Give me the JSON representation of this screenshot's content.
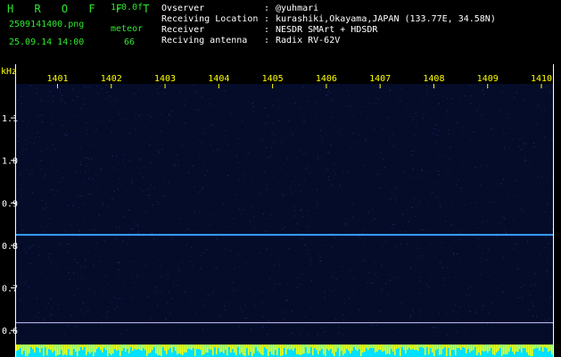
{
  "header": {
    "title": "H R O F F T",
    "version": "1.0.0f",
    "filename": "2509141400.png",
    "timestamp": "25.09.14 14:00",
    "mode_label": "meteor",
    "count": "66",
    "info": [
      {
        "label": "Ovserver",
        "value": "@yuhmari"
      },
      {
        "label": "Receiving Location",
        "value": "kurashiki,Okayama,JAPAN (133.77E, 34.58N)"
      },
      {
        "label": "Receiver",
        "value": "NESDR SMArt + HDSDR"
      },
      {
        "label": "Reciving antenna",
        "value": "Radix RV-62V"
      }
    ]
  },
  "chart_data": {
    "type": "heatmap",
    "y_unit": "kHz",
    "x_ticks": [
      "1401",
      "1402",
      "1403",
      "1404",
      "1405",
      "1406",
      "1407",
      "1408",
      "1409",
      "1410"
    ],
    "y_ticks": [
      "1.1",
      "1.0",
      "0.9",
      "0.8",
      "0.7",
      "0.6"
    ],
    "y_range": [
      0.59,
      1.18
    ],
    "signal_line_khz": 0.825,
    "reference_line_khz": 0.618,
    "colors": {
      "background": "#040c2a",
      "signal": "#3aa0ff",
      "reference": "#c8c8ff",
      "activity_yellow": "#ffff00",
      "activity_cyan": "#00e0ff",
      "labels": "#ffff00"
    }
  }
}
